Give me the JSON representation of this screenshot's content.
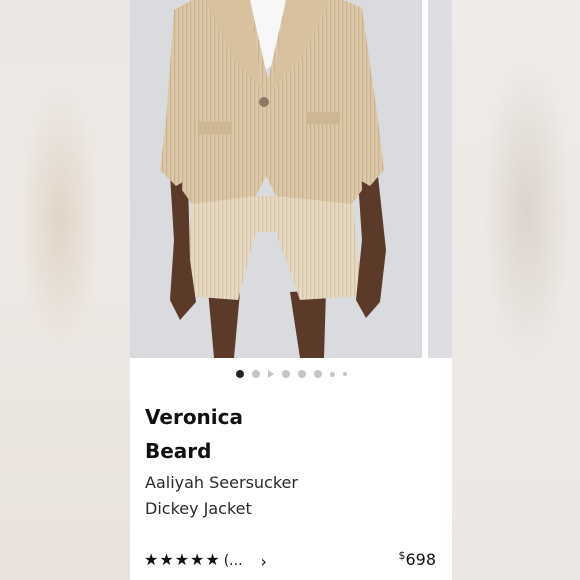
{
  "product": {
    "brand": "Veronica Beard",
    "name": "Aaliyah Seersucker Dickey Jacket",
    "rating_stars": 5,
    "review_count_label": "(...",
    "price_symbol": "$",
    "price_amount": "698"
  },
  "carousel": {
    "image_icon": "product-photo",
    "next_icon": "chevron-right-icon"
  },
  "colors": {
    "jacket": "#d9c4a3",
    "background": "#dadbde",
    "text": "#111111"
  }
}
